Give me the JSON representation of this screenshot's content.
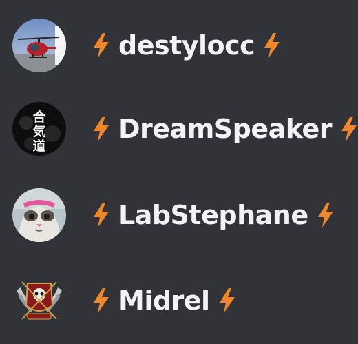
{
  "colors": {
    "background": "#313338",
    "name_text": "#f2f3f5",
    "bolt": "#f0882b"
  },
  "members": [
    {
      "name": "destylocc",
      "avatar_icon": "helicopter-avatar-icon",
      "decoration_icon": "lightning-bolt-icon"
    },
    {
      "name": "DreamSpeaker",
      "avatar_icon": "aikido-kanji-avatar-icon",
      "decoration_icon": "lightning-bolt-icon"
    },
    {
      "name": "LabStephane",
      "avatar_icon": "cat-avatar-icon",
      "decoration_icon": "lightning-bolt-icon"
    },
    {
      "name": "Midrel",
      "avatar_icon": "skull-crest-avatar-icon",
      "decoration_icon": "lightning-bolt-icon"
    }
  ],
  "avatar_kanji": [
    "合",
    "気",
    "道"
  ]
}
